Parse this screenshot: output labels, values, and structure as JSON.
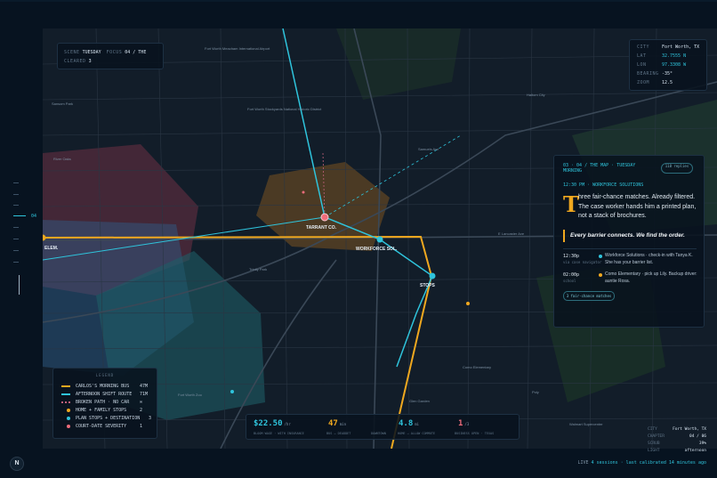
{
  "scene": {
    "scene_label": "SCENE",
    "scene_value": "TUESDAY",
    "focus_label": "FOCUS",
    "focus_value": "04 / THE",
    "cleared_label": "CLEARED",
    "cleared_value": "3"
  },
  "coords": {
    "rows": [
      {
        "k": "CITY",
        "v": "Fort Worth, TX"
      },
      {
        "k": "LAT",
        "v": "32.7555 N"
      },
      {
        "k": "LON",
        "v": "97.3308 W"
      },
      {
        "k": "BEARING",
        "v": "-35°"
      },
      {
        "k": "ZOOM",
        "v": "12.5"
      }
    ]
  },
  "story": {
    "heading": "03 · 04 / THE MAP · TUESDAY",
    "heading2": "MORNING",
    "badge": "118 replies",
    "subhead": "12:30 PM · WORKFORCE SOLUTIONS",
    "dropcap": "T",
    "body": "hree fair-chance matches. Already filtered. The case worker hands him a printed plan, not a stack of brochures.",
    "quote": "Every barrier connects. We find the order.",
    "timeline": [
      {
        "time": "12:30p",
        "label": "via case navigator",
        "text": "Workforce Solutions · check-in with Tanya K. She has your barrier list.",
        "color": "#2fc4dc"
      },
      {
        "time": "02:00p",
        "label": "school",
        "text": "Como Elementary · pick up Lily. Backup driver: auntie Rosa.",
        "color": "#f0a81f"
      }
    ],
    "chip": "3 fair-chance matches"
  },
  "legend": {
    "title": "LEGEND",
    "items": [
      {
        "name": "CARLOS'S MORNING BUS",
        "value": "47M",
        "color": "#f0a81f",
        "kind": "line"
      },
      {
        "name": "AFTERNOON SHIFT ROUTE",
        "value": "71M",
        "color": "#2fc4dc",
        "kind": "line"
      },
      {
        "name": "BROKEN PATH · NO CAR",
        "value": "∞",
        "color": "#c0607a",
        "kind": "dash"
      },
      {
        "name": "HOME + FAMILY STOPS",
        "value": "2",
        "color": "#f0a81f",
        "kind": "dot"
      },
      {
        "name": "PLAN STOPS + DESTINATION",
        "value": "3",
        "color": "#2fc4dc",
        "kind": "dot"
      },
      {
        "name": "COURT-DATE SEVERITY",
        "value": "1",
        "color": "#f06c7b",
        "kind": "dot"
      }
    ]
  },
  "stats": [
    {
      "value": "$22.50",
      "unit": "/hr",
      "label": "BLOOM WAGE · WITH INSURANCE",
      "color": "#2fc4dc"
    },
    {
      "value": "47",
      "unit": "min",
      "label": "BUS → DEADDET",
      "color": "#f0a81f"
    },
    {
      "value": "",
      "unit": "",
      "label": "DOWNTOWN",
      "color": "#c9d6e3"
    },
    {
      "value": "4.8",
      "unit": "mi",
      "label": "HOME → ALLOW COMMUTE",
      "color": "#2fc4dc"
    },
    {
      "value": "1",
      "unit": "/3",
      "label": "BUSINESS OPEN · TEXAS",
      "color": "#f06c7b"
    }
  ],
  "map_labels": {
    "tarrant": "TARRANT CO.",
    "workforce": "WORKFORCE SOL.",
    "stops": "STOPS",
    "elem": "ELEM."
  },
  "streets": [
    "Sansom Park",
    "River Oaks",
    "Fort Worth Zoo",
    "Trinity Park",
    "Haltom City",
    "Samuels Ave",
    "E Lancaster Ave",
    "Como Elementary",
    "Glen Garden",
    "Poly",
    "Walmart Supercenter",
    "Fort Worth Meacham International Airport",
    "Fort Worth Stockyards National Historic District",
    "Hillcrest Ave"
  ],
  "rail": {
    "active": "04"
  },
  "logo": "N",
  "bottom_right": [
    {
      "k": "CITY",
      "v": "Fort Worth, TX"
    },
    {
      "k": "CHAPTER",
      "v": "04 / 06"
    },
    {
      "k": "SCRUB",
      "v": "39%"
    },
    {
      "k": "LIGHT",
      "v": "afternoon"
    }
  ],
  "footer": {
    "live": "LIVE",
    "text": "4 sessions · last calibrated 14 minutes ago"
  }
}
